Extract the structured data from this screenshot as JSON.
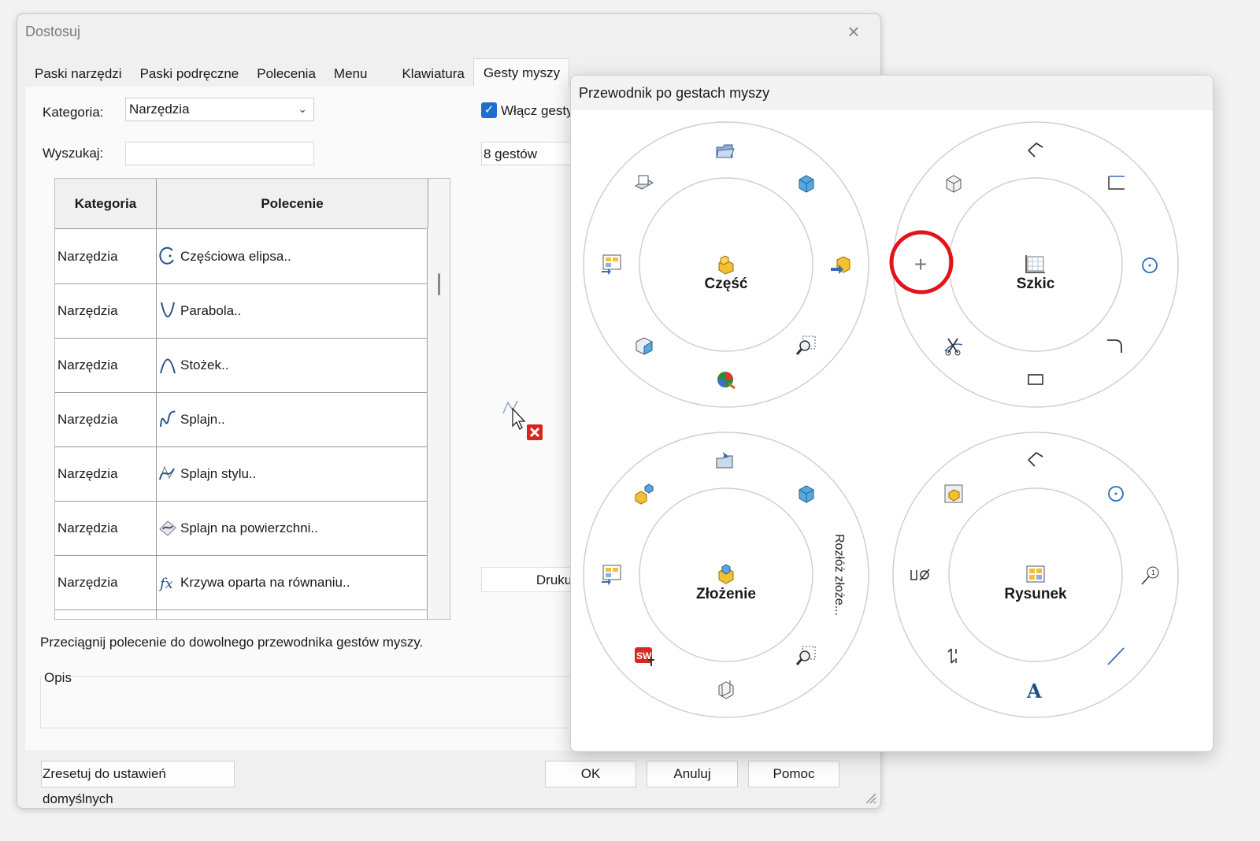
{
  "dialog": {
    "title": "Dostosuj",
    "tabs": [
      "Paski narzędzi",
      "Paski podręczne",
      "Polecenia",
      "Menu",
      "Klawiatura",
      "Gesty myszy"
    ],
    "active_tab": "Gesty myszy",
    "category_label": "Kategoria:",
    "category_value": "Narzędzia",
    "search_label": "Wyszukaj:",
    "search_value": "",
    "table": {
      "headers": [
        "Kategoria",
        "Polecenie"
      ],
      "rows": [
        {
          "category": "Narzędzia",
          "command": "Częściowa elipsa..",
          "icon": "partial-ellipse-icon"
        },
        {
          "category": "Narzędzia",
          "command": "Parabola..",
          "icon": "parabola-icon"
        },
        {
          "category": "Narzędzia",
          "command": "Stożek..",
          "icon": "conic-icon"
        },
        {
          "category": "Narzędzia",
          "command": "Splajn..",
          "icon": "spline-icon"
        },
        {
          "category": "Narzędzia",
          "command": "Splajn stylu..",
          "icon": "style-spline-icon"
        },
        {
          "category": "Narzędzia",
          "command": "Splajn na powierzchni..",
          "icon": "spline-on-surface-icon"
        },
        {
          "category": "Narzędzia",
          "command": "Krzywa oparta na równaniu..",
          "icon": "equation-curve-icon"
        }
      ]
    },
    "enable_label": "Włącz gesty",
    "enable_checked": true,
    "gestures_value": "8 gestów",
    "print_label": "Drukuj",
    "hint": "Przeciągnij polecenie do dowolnego przewodnika gestów myszy.",
    "description_label": "Opis",
    "reset_label": "Zresetuj do ustawień domyślnych",
    "ok_label": "OK",
    "cancel_label": "Anuluj",
    "help_label": "Pomoc"
  },
  "guide": {
    "title": "Przewodnik po gestach myszy",
    "wheels": [
      {
        "label": "Część",
        "icons": [
          "open-icon",
          "view-cube-icon",
          "part-arrow-icon",
          "zoom-to-fit-icon",
          "appearance-icon",
          "isometric-view-icon",
          "drawing-from-part-icon",
          "normal-to-icon"
        ]
      },
      {
        "label": "Szkic",
        "icons": [
          "line-icon",
          "corner-rectangle-icon",
          "circle-icon",
          "fillet-icon",
          "rectangle-icon",
          "trim-icon",
          "empty-slot-plus-icon",
          "box-view-icon"
        ]
      },
      {
        "label": "Złożenie",
        "icons": [
          "insert-component-icon",
          "view-cube-icon",
          "zoom-to-fit-icon",
          "section-view-icon",
          "solidworks-icon",
          "drawing-from-assembly-icon",
          "mate-icon"
        ],
        "side_text": "Rozłóż złoże..."
      },
      {
        "label": "Rysunek",
        "icons": [
          "line-icon",
          "circle-icon",
          "balloon-icon",
          "line-diagonal-icon",
          "note-icon",
          "dimension-arrows-icon",
          "hole-callout-icon",
          "model-view-icon"
        ]
      }
    ],
    "highlight_color": "#e3131b"
  }
}
